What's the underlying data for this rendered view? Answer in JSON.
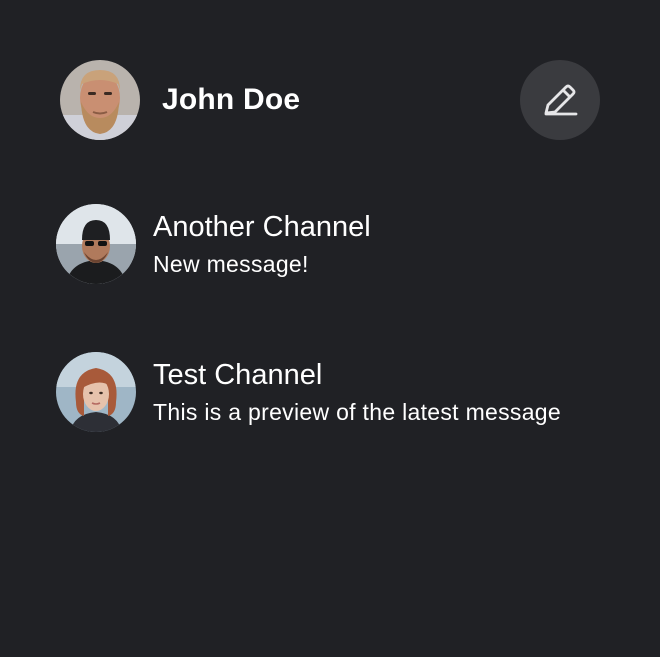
{
  "user": {
    "name": "John Doe",
    "avatar_icon": "bearded-man-avatar"
  },
  "header": {
    "edit_icon": "pencil-icon"
  },
  "channels": [
    {
      "name": "Another Channel",
      "preview": "New message!",
      "avatar_icon": "man-with-beanie-avatar"
    },
    {
      "name": "Test Channel",
      "preview": "This is a preview of the latest message",
      "avatar_icon": "red-haired-woman-avatar"
    }
  ],
  "colors": {
    "background": "#202125",
    "edit_button": "#3a3b3f",
    "text": "#ffffff"
  }
}
